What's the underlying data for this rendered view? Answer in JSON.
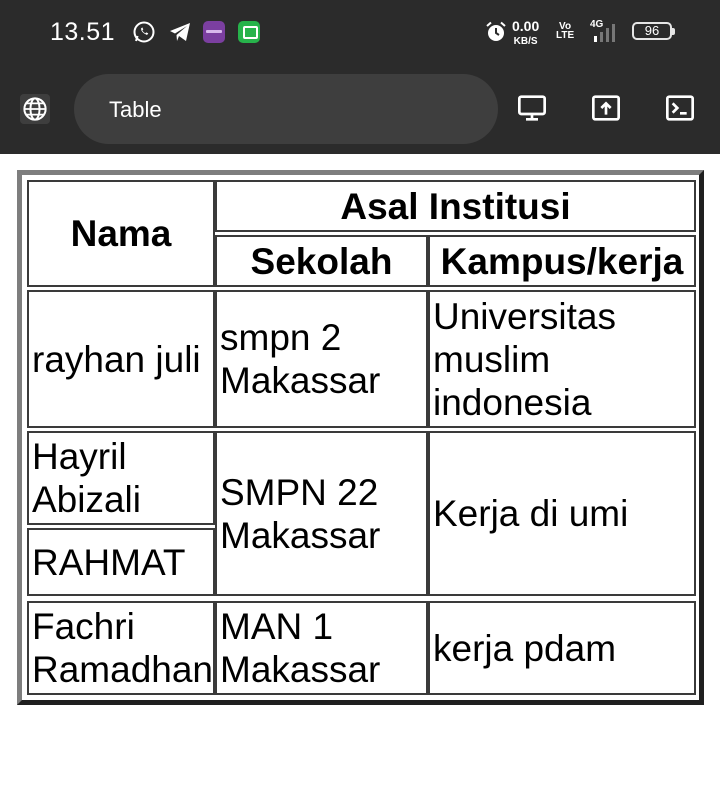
{
  "status": {
    "time": "13.51",
    "net_speed": "0.00",
    "net_unit": "KB/S",
    "volte_top": "Vo",
    "volte_bottom": "LTE",
    "network": "4G",
    "battery": "96"
  },
  "browser": {
    "page_title": "Table",
    "icons": [
      "globe-icon",
      "desktop-icon",
      "share-icon",
      "terminal-icon"
    ]
  },
  "table": {
    "headers": {
      "nama": "Nama",
      "asal_institusi": "Asal Institusi",
      "sekolah": "Sekolah",
      "kampus_kerja": "Kampus/kerja"
    },
    "rows": [
      {
        "nama": "rayhan juli",
        "sekolah": "smpn 2 Makassar",
        "kampus": "Universitas muslim indonesia"
      },
      {
        "nama": "Hayril Abizali",
        "sekolah": "SMPN 22 Makassar",
        "kampus": "Kerja di umi"
      },
      {
        "nama": "RAHMAT"
      },
      {
        "nama": "Fachri Ramadhan",
        "sekolah": "MAN 1 Makassar",
        "kampus": "kerja pdam"
      }
    ]
  },
  "colors": {
    "bar_background": "#2b2b2b",
    "url_pill": "#3e3e3e",
    "whatsapp": "#ffffff",
    "app_purple": "#7b3fa0",
    "app_green": "#27b34b"
  }
}
